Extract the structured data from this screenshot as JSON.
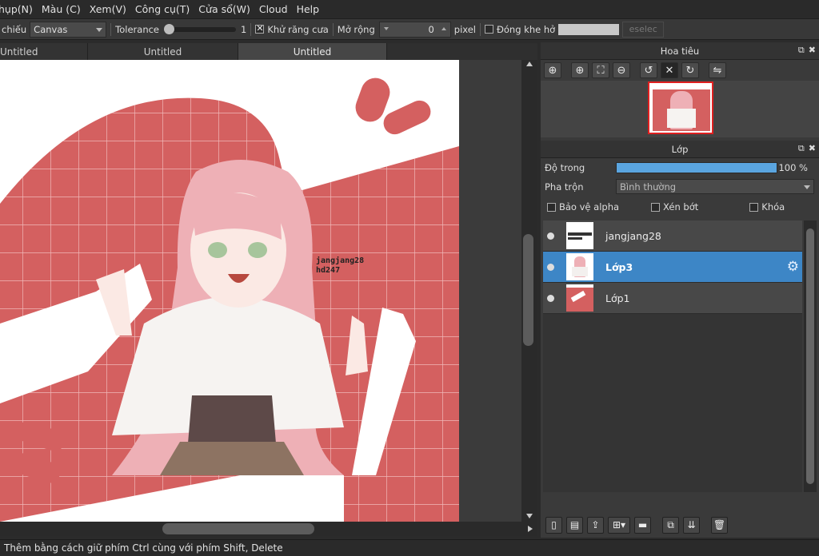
{
  "menu": [
    "hụp(N)",
    "Màu (C)",
    "Xem(V)",
    "Công cụ(T)",
    "Cửa sổ(W)",
    "Cloud",
    "Help"
  ],
  "toolbar": {
    "reference_label": "chiếu",
    "reference_value": "Canvas",
    "tolerance_label": "Tolerance",
    "tolerance_value": "1",
    "antialias_label": "Khử răng cưa",
    "antialias_checked": true,
    "expand_label": "Mở rộng",
    "expand_value": "0",
    "pixel_label": "pixel",
    "close_gap_label": "Đóng khe hở",
    "close_gap_checked": false,
    "deselect_label": "eselec"
  },
  "tabs": [
    {
      "label": "Untitled",
      "active": false
    },
    {
      "label": "Untitled",
      "active": false
    },
    {
      "label": "Untitled",
      "active": true
    }
  ],
  "artwork": {
    "bg_color": "#d46060",
    "watermark_line1": "jangjang28",
    "watermark_line2": "hd247"
  },
  "navigator": {
    "title": "Hoa tiêu",
    "tools": [
      "zoom-in-search-icon",
      "zoom-in-icon",
      "fit-icon",
      "zoom-out-icon",
      "rotate-left-icon",
      "reset-view-icon",
      "rotate-right-icon",
      "flip-icon"
    ]
  },
  "layers_panel": {
    "title": "Lớp",
    "opacity_label": "Độ trong",
    "opacity_value": "100 %",
    "opacity_level": 100,
    "blend_label": "Pha trộn",
    "blend_value": "Bình thường",
    "protect_alpha_label": "Bảo vệ alpha",
    "clipping_label": "Xén bớt",
    "lock_label": "Khóa",
    "layers": [
      {
        "name": "jangjang28",
        "selected": false
      },
      {
        "name": "Lớp3",
        "selected": true
      },
      {
        "name": "Lớp1",
        "selected": false
      }
    ]
  },
  "status": "Thêm bằng cách giữ phím Ctrl cùng với phím Shift, Delete"
}
